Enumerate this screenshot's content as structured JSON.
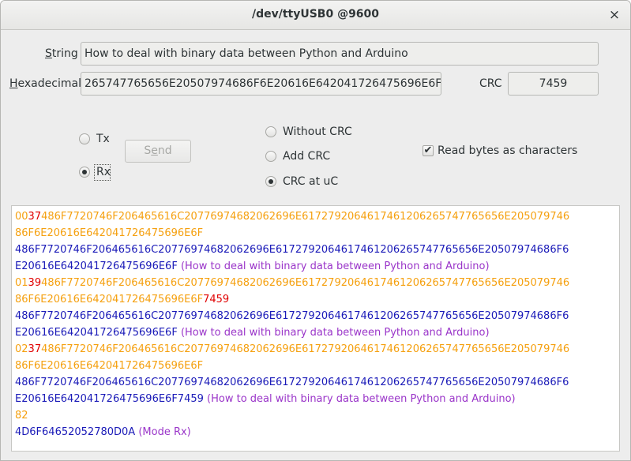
{
  "window": {
    "title": "/dev/ttyUSB0 @9600",
    "close_glyph": "×"
  },
  "fields": {
    "string_label_first": "S",
    "string_label_rest": "tring",
    "string_value": "How to deal with binary data between Python and Arduino",
    "hex_label_first": "H",
    "hex_label_rest": "exadecimal",
    "hex_value": "265747765656E20507974686F6E20616E642041726475696E6F",
    "crc_label": "CRC",
    "crc_value": "7459"
  },
  "controls": {
    "tx_label": "Tx",
    "rx_label": "Rx",
    "tx_selected": false,
    "rx_selected": true,
    "send_label_first": "S",
    "send_label_underlined": "e",
    "send_label_rest": "nd",
    "crc_modes": [
      {
        "label": "Without CRC",
        "selected": false
      },
      {
        "label": "Add CRC",
        "selected": false
      },
      {
        "label": "CRC at uC",
        "selected": true
      }
    ],
    "read_as_chars_label": "Read bytes as characters",
    "read_as_chars_checked": true
  },
  "log": {
    "lines": [
      [
        {
          "c": "orange",
          "t": "00"
        },
        {
          "c": "red",
          "t": "37"
        },
        {
          "c": "orange",
          "t": "486F7720746F206465616C20776974682062696E6172792064617461206265747765656E205079746"
        }
      ],
      [
        {
          "c": "orange",
          "t": "86F6E20616E642041726475696E6F"
        }
      ],
      [
        {
          "c": "blue",
          "t": "486F7720746F206465616C20776974682062696E6172792064617461206265747765656E20507974686F6"
        }
      ],
      [
        {
          "c": "blue",
          "t": "E20616E642041726475696E6F "
        },
        {
          "c": "purple",
          "t": "(How to deal with binary data between Python and Arduino)"
        }
      ],
      [
        {
          "c": "orange",
          "t": "01"
        },
        {
          "c": "red",
          "t": "39"
        },
        {
          "c": "orange",
          "t": "486F7720746F206465616C20776974682062696E6172792064617461206265747765656E205079746"
        }
      ],
      [
        {
          "c": "orange",
          "t": "86F6E20616E642041726475696E6F"
        },
        {
          "c": "red",
          "t": "7459"
        }
      ],
      [
        {
          "c": "blue",
          "t": "486F7720746F206465616C20776974682062696E6172792064617461206265747765656E20507974686F6"
        }
      ],
      [
        {
          "c": "blue",
          "t": "E20616E642041726475696E6F "
        },
        {
          "c": "purple",
          "t": "(How to deal with binary data between Python and Arduino)"
        }
      ],
      [
        {
          "c": "orange",
          "t": "02"
        },
        {
          "c": "red",
          "t": "37"
        },
        {
          "c": "orange",
          "t": "486F7720746F206465616C20776974682062696E6172792064617461206265747765656E205079746"
        }
      ],
      [
        {
          "c": "orange",
          "t": "86F6E20616E642041726475696E6F"
        }
      ],
      [
        {
          "c": "blue",
          "t": "486F7720746F206465616C20776974682062696E6172792064617461206265747765656E20507974686F6"
        }
      ],
      [
        {
          "c": "blue",
          "t": "E20616E642041726475696E6F7459 "
        },
        {
          "c": "purple",
          "t": "(How to deal with binary data between Python and Arduino)"
        }
      ],
      [
        {
          "c": "orange",
          "t": "82"
        }
      ],
      [
        {
          "c": "blue",
          "t": "4D6F64652052780D0A "
        },
        {
          "c": "purple",
          "t": "(Mode Rx)"
        }
      ]
    ]
  }
}
